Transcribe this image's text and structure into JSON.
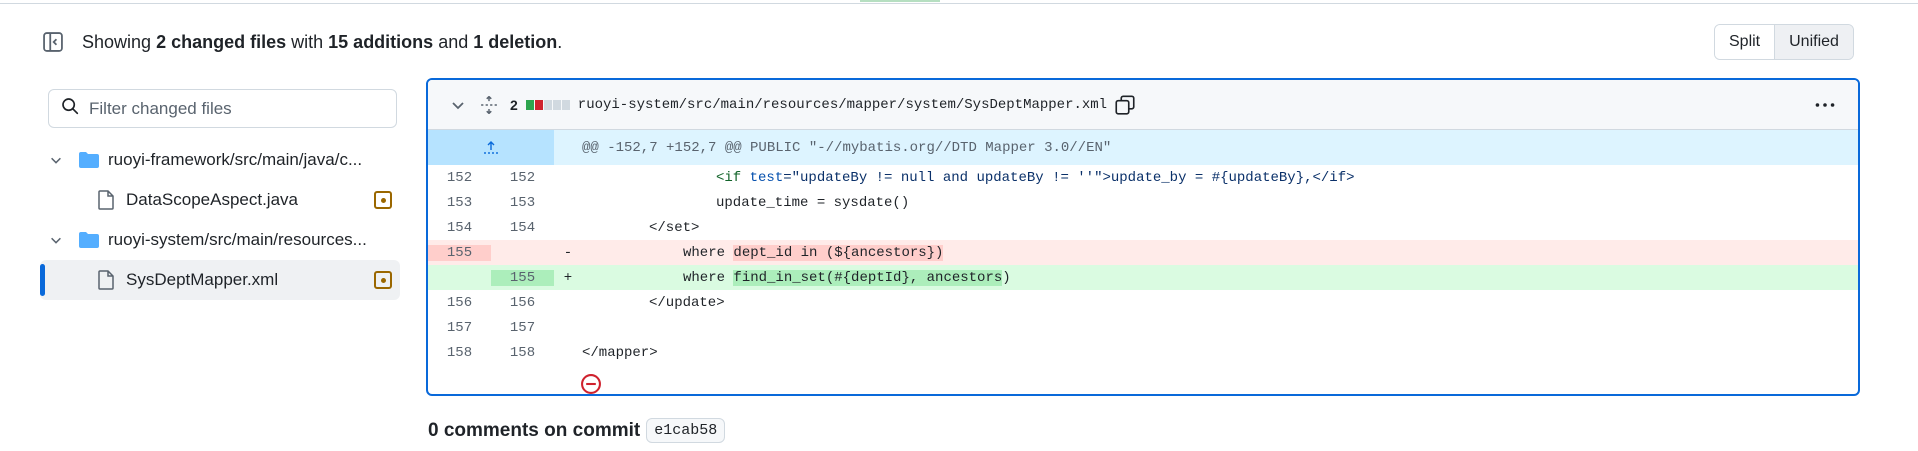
{
  "summary": {
    "prefix": "Showing",
    "files": "2 changed files",
    "with": "with",
    "additions": "15 additions",
    "and": "and",
    "deletions": "1 deletion",
    "period": "."
  },
  "view_toggle": {
    "split": "Split",
    "unified": "Unified",
    "selected": "Unified"
  },
  "filter": {
    "placeholder": "Filter changed files"
  },
  "tree": [
    {
      "type": "folder",
      "label": "ruoyi-framework/src/main/java/c..."
    },
    {
      "type": "file",
      "label": "DataScopeAspect.java",
      "status": "modified"
    },
    {
      "type": "folder",
      "label": "ruoyi-system/src/main/resources..."
    },
    {
      "type": "file",
      "label": "SysDeptMapper.xml",
      "status": "modified",
      "selected": true
    }
  ],
  "file": {
    "changes": "2",
    "path": "ruoyi-system/src/main/resources/mapper/system/SysDeptMapper.xml",
    "hunk_header": "@@ -152,7 +152,7 @@ PUBLIC \"-//mybatis.org//DTD Mapper 3.0//EN\"",
    "lines": [
      {
        "old": "152",
        "new": "152",
        "sign": "",
        "type": "ctx"
      },
      {
        "old": "153",
        "new": "153",
        "sign": "",
        "type": "ctx"
      },
      {
        "old": "154",
        "new": "154",
        "sign": "",
        "type": "ctx"
      },
      {
        "old": "155",
        "new": "",
        "sign": "-",
        "type": "del"
      },
      {
        "old": "",
        "new": "155",
        "sign": "+",
        "type": "add"
      },
      {
        "old": "156",
        "new": "156",
        "sign": "",
        "type": "ctx"
      },
      {
        "old": "157",
        "new": "157",
        "sign": "",
        "type": "ctx"
      },
      {
        "old": "158",
        "new": "158",
        "sign": "",
        "type": "ctx"
      }
    ],
    "code": {
      "l152_a": "<if ",
      "l152_attr": "test",
      "l152_b": "=\"updateBy != null and updateBy != ''\">update_by = #{updateBy},</if>",
      "l153": "update_time = sysdate()",
      "l154": "</set>",
      "l155_del_a": "where ",
      "l155_del_hl": "dept_id in (${ancestors})",
      "l155_add_a": "where ",
      "l155_add_hl": "find_in_set(#{deptId}, ancestors",
      "l155_add_b": ")",
      "l156": "</update>",
      "l157": "",
      "l158": "</mapper>"
    }
  },
  "comments": {
    "title": "0 comments on commit",
    "sha": "e1cab58"
  },
  "colors": {
    "accent": "#0969da",
    "addition": "#2da44e",
    "deletion": "#cf222e",
    "modified": "#9a6700"
  }
}
